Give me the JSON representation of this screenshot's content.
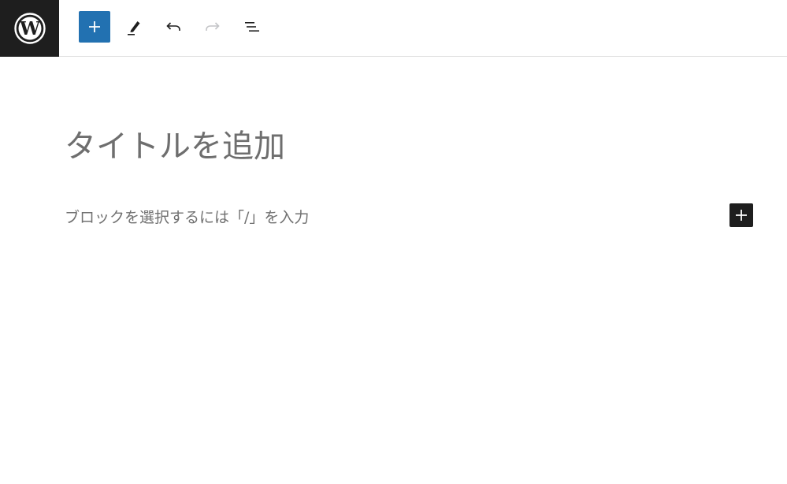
{
  "header": {
    "logo_icon": "wordpress-logo-icon",
    "tools": [
      {
        "name": "block-inserter-toggle",
        "icon": "plus-icon",
        "color": "#2271b1"
      },
      {
        "name": "tools-edit",
        "icon": "pencil-icon"
      },
      {
        "name": "undo",
        "icon": "undo-icon"
      },
      {
        "name": "redo",
        "icon": "redo-icon",
        "disabled": true
      },
      {
        "name": "list-view",
        "icon": "list-view-icon"
      }
    ]
  },
  "editor": {
    "title_placeholder": "タイトルを追加",
    "block_placeholder": "ブロックを選択するには「/」を入力",
    "block_inserter_icon": "plus-icon"
  },
  "colors": {
    "logo_background": "#1e1e1e",
    "accent": "#2271b1",
    "placeholder_text": "#707070"
  }
}
